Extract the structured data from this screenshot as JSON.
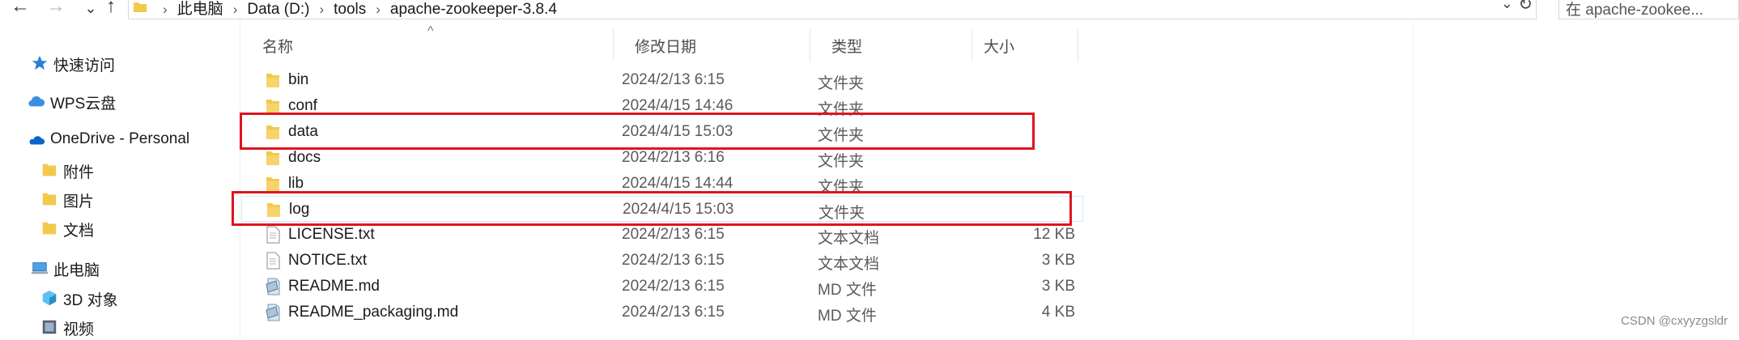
{
  "address_bar": {
    "breadcrumbs": [
      "此电脑",
      "Data (D:)",
      "tools",
      "apache-zookeeper-3.8.4"
    ],
    "search_placeholder": "在 apache-zookee..."
  },
  "nav_pane": {
    "items": [
      {
        "label": "快速访问",
        "icon": "star-icon"
      },
      {
        "label": "WPS云盘",
        "icon": "cloud-icon"
      },
      {
        "label": "OneDrive - Personal",
        "icon": "onedrive-cloud-icon"
      },
      {
        "label": "附件",
        "icon": "folder-icon"
      },
      {
        "label": "图片",
        "icon": "folder-icon"
      },
      {
        "label": "文档",
        "icon": "folder-icon"
      },
      {
        "label": "此电脑",
        "icon": "computer-icon"
      },
      {
        "label": "3D 对象",
        "icon": "cube-icon"
      },
      {
        "label": "视频",
        "icon": "video-icon"
      }
    ]
  },
  "file_list": {
    "columns": {
      "name": "名称",
      "modified": "修改日期",
      "type": "类型",
      "size": "大小"
    },
    "rows": [
      {
        "name": "bin",
        "modified": "2024/2/13 6:15",
        "type": "文件夹",
        "size": "",
        "kind": "folder"
      },
      {
        "name": "conf",
        "modified": "2024/4/15 14:46",
        "type": "文件夹",
        "size": "",
        "kind": "folder"
      },
      {
        "name": "data",
        "modified": "2024/4/15 15:03",
        "type": "文件夹",
        "size": "",
        "kind": "folder"
      },
      {
        "name": "docs",
        "modified": "2024/2/13 6:16",
        "type": "文件夹",
        "size": "",
        "kind": "folder"
      },
      {
        "name": "lib",
        "modified": "2024/4/15 14:44",
        "type": "文件夹",
        "size": "",
        "kind": "folder"
      },
      {
        "name": "log",
        "modified": "2024/4/15 15:03",
        "type": "文件夹",
        "size": "",
        "kind": "folder"
      },
      {
        "name": "LICENSE.txt",
        "modified": "2024/2/13 6:15",
        "type": "文本文档",
        "size": "12 KB",
        "kind": "text"
      },
      {
        "name": "NOTICE.txt",
        "modified": "2024/2/13 6:15",
        "type": "文本文档",
        "size": "3 KB",
        "kind": "text"
      },
      {
        "name": "README.md",
        "modified": "2024/2/13 6:15",
        "type": "MD 文件",
        "size": "3 KB",
        "kind": "md"
      },
      {
        "name": "README_packaging.md",
        "modified": "2024/2/13 6:15",
        "type": "MD 文件",
        "size": "4 KB",
        "kind": "md"
      }
    ]
  },
  "highlight_color": "#e0141e",
  "folder_color": "#f2c94c",
  "watermark": "CSDN @cxyyzgsldr"
}
